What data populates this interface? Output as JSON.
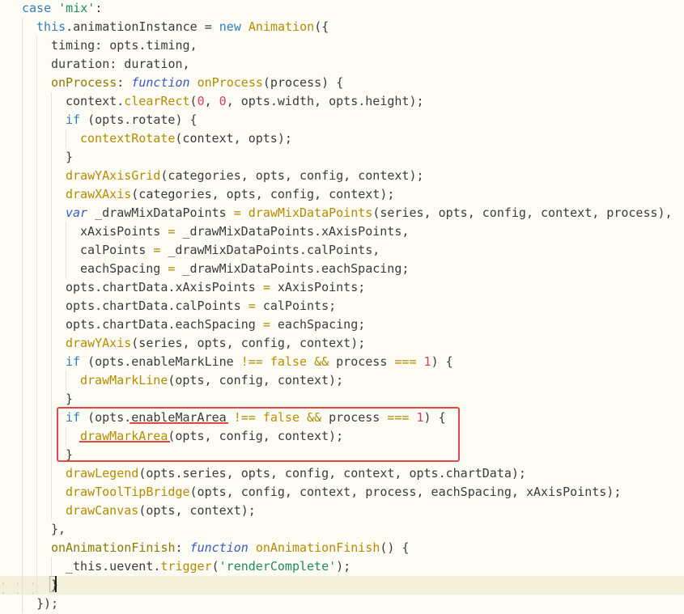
{
  "lines": [
    {
      "tokens": [
        [
          "kw",
          "case"
        ],
        [
          "plain",
          " "
        ],
        [
          "str",
          "'mix'"
        ],
        [
          "plain",
          ":"
        ]
      ]
    },
    {
      "tokens": [
        [
          "kw",
          "this"
        ],
        [
          "plain",
          ".animationInstance = "
        ],
        [
          "kw",
          "new"
        ],
        [
          "plain",
          " "
        ],
        [
          "fn",
          "Animation"
        ],
        [
          "plain",
          "({"
        ]
      ]
    },
    {
      "tokens": [
        [
          "plain",
          "timing: opts.timing,"
        ]
      ]
    },
    {
      "tokens": [
        [
          "plain",
          "duration: duration,"
        ]
      ]
    },
    {
      "tokens": [
        [
          "prop",
          "onProcess"
        ],
        [
          "plain",
          ": "
        ],
        [
          "fnkw",
          "function"
        ],
        [
          "plain",
          " "
        ],
        [
          "fn",
          "onProcess"
        ],
        [
          "plain",
          "(process) {"
        ]
      ]
    },
    {
      "tokens": [
        [
          "plain",
          "context."
        ],
        [
          "fn",
          "clearRect"
        ],
        [
          "plain",
          "("
        ],
        [
          "num",
          "0"
        ],
        [
          "plain",
          ", "
        ],
        [
          "num",
          "0"
        ],
        [
          "plain",
          ", opts.width, opts.height);"
        ]
      ]
    },
    {
      "tokens": [
        [
          "kw",
          "if"
        ],
        [
          "plain",
          " (opts.rotate) {"
        ]
      ]
    },
    {
      "tokens": [
        [
          "fn",
          "contextRotate"
        ],
        [
          "plain",
          "(context, opts);"
        ]
      ]
    },
    {
      "tokens": [
        [
          "plain",
          "}"
        ]
      ]
    },
    {
      "tokens": [
        [
          "fn",
          "drawYAxisGrid"
        ],
        [
          "plain",
          "(categories, opts, config, context);"
        ]
      ]
    },
    {
      "tokens": [
        [
          "fn",
          "drawXAxis"
        ],
        [
          "plain",
          "(categories, opts, config, context);"
        ]
      ]
    },
    {
      "tokens": [
        [
          "fnkw",
          "var"
        ],
        [
          "plain",
          " _drawMixDataPoints "
        ],
        [
          "op",
          "="
        ],
        [
          "plain",
          " "
        ],
        [
          "fn",
          "drawMixDataPoints"
        ],
        [
          "plain",
          "(series, opts, config, context, process),"
        ]
      ]
    },
    {
      "tokens": [
        [
          "plain",
          "xAxisPoints "
        ],
        [
          "op",
          "="
        ],
        [
          "plain",
          " _drawMixDataPoints.xAxisPoints,"
        ]
      ]
    },
    {
      "tokens": [
        [
          "plain",
          "calPoints "
        ],
        [
          "op",
          "="
        ],
        [
          "plain",
          " _drawMixDataPoints.calPoints,"
        ]
      ]
    },
    {
      "tokens": [
        [
          "plain",
          "eachSpacing "
        ],
        [
          "op",
          "="
        ],
        [
          "plain",
          " _drawMixDataPoints.eachSpacing;"
        ]
      ]
    },
    {
      "tokens": [
        [
          "plain",
          "opts.chartData.xAxisPoints "
        ],
        [
          "op",
          "="
        ],
        [
          "plain",
          " xAxisPoints;"
        ]
      ]
    },
    {
      "tokens": [
        [
          "plain",
          "opts.chartData.calPoints "
        ],
        [
          "op",
          "="
        ],
        [
          "plain",
          " calPoints;"
        ]
      ]
    },
    {
      "tokens": [
        [
          "plain",
          "opts.chartData.eachSpacing "
        ],
        [
          "op",
          "="
        ],
        [
          "plain",
          " eachSpacing;"
        ]
      ]
    },
    {
      "tokens": [
        [
          "fn",
          "drawYAxis"
        ],
        [
          "plain",
          "(series, opts, config, context);"
        ]
      ]
    },
    {
      "tokens": [
        [
          "kw",
          "if"
        ],
        [
          "plain",
          " (opts.enableMarkLine "
        ],
        [
          "op",
          "!=="
        ],
        [
          "plain",
          " "
        ],
        [
          "bool",
          "false"
        ],
        [
          "plain",
          " "
        ],
        [
          "op",
          "&&"
        ],
        [
          "plain",
          " process "
        ],
        [
          "op",
          "==="
        ],
        [
          "plain",
          " "
        ],
        [
          "num",
          "1"
        ],
        [
          "plain",
          ") {"
        ]
      ]
    },
    {
      "tokens": [
        [
          "fn",
          "drawMarkLine"
        ],
        [
          "plain",
          "(opts, config, context);"
        ]
      ]
    },
    {
      "tokens": [
        [
          "plain",
          "}"
        ]
      ]
    },
    {
      "tokens": [
        [
          "kw",
          "if"
        ],
        [
          "plain",
          " (opts."
        ],
        [
          "plain",
          "enableMarArea"
        ],
        [
          "plain",
          " "
        ],
        [
          "op",
          "!=="
        ],
        [
          "plain",
          " "
        ],
        [
          "bool",
          "false"
        ],
        [
          "plain",
          " "
        ],
        [
          "op",
          "&&"
        ],
        [
          "plain",
          " process "
        ],
        [
          "op",
          "==="
        ],
        [
          "plain",
          " "
        ],
        [
          "num",
          "1"
        ],
        [
          "plain",
          ") {"
        ]
      ]
    },
    {
      "tokens": [
        [
          "fn",
          "drawMarkArea"
        ],
        [
          "plain",
          "(opts, config, context);"
        ]
      ]
    },
    {
      "tokens": [
        [
          "plain",
          "}"
        ]
      ]
    },
    {
      "tokens": [
        [
          "fn",
          "drawLegend"
        ],
        [
          "plain",
          "(opts.series, opts, config, context, opts.chartData);"
        ]
      ]
    },
    {
      "tokens": [
        [
          "fn",
          "drawToolTipBridge"
        ],
        [
          "plain",
          "(opts, config, context, process, eachSpacing, xAxisPoints);"
        ]
      ]
    },
    {
      "tokens": [
        [
          "fn",
          "drawCanvas"
        ],
        [
          "plain",
          "(opts, context);"
        ]
      ]
    },
    {
      "tokens": [
        [
          "plain",
          "},"
        ]
      ]
    },
    {
      "tokens": [
        [
          "prop",
          "onAnimationFinish"
        ],
        [
          "plain",
          ": "
        ],
        [
          "fnkw",
          "function"
        ],
        [
          "plain",
          " "
        ],
        [
          "fn",
          "onAnimationFinish"
        ],
        [
          "plain",
          "() {"
        ]
      ]
    },
    {
      "tokens": [
        [
          "plain",
          "_this.uevent."
        ],
        [
          "fn",
          "trigger"
        ],
        [
          "plain",
          "("
        ],
        [
          "str",
          "'renderComplete'"
        ],
        [
          "plain",
          ");"
        ]
      ]
    },
    {
      "tokens": [
        [
          "plain",
          "}"
        ]
      ]
    },
    {
      "tokens": [
        [
          "plain",
          "});"
        ]
      ]
    }
  ]
}
